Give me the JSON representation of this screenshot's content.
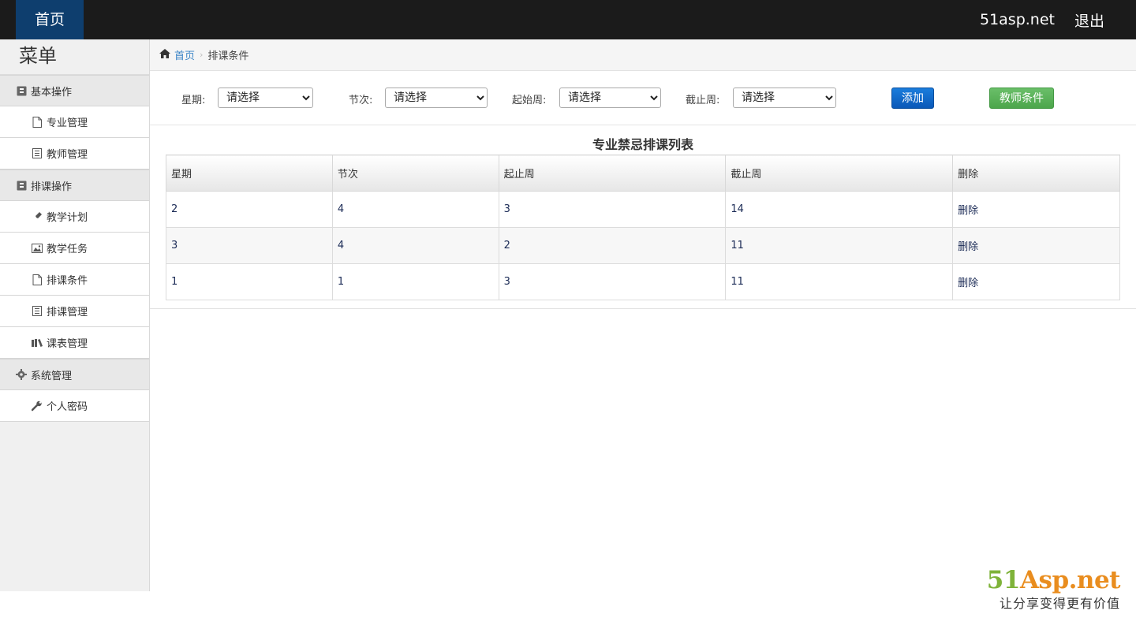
{
  "topbar": {
    "home_label": "首页",
    "site_label": "51asp.net",
    "logout_label": "退出"
  },
  "sidebar": {
    "title": "菜单",
    "groups": [
      {
        "label": "基本操作",
        "icon": "book-icon",
        "items": [
          {
            "label": "专业管理",
            "icon": "file-icon"
          },
          {
            "label": "教师管理",
            "icon": "list-icon"
          }
        ]
      },
      {
        "label": "排课操作",
        "icon": "book-icon",
        "items": [
          {
            "label": "教学计划",
            "icon": "fire-icon"
          },
          {
            "label": "教学任务",
            "icon": "picture-icon"
          },
          {
            "label": "排课条件",
            "icon": "file-icon"
          },
          {
            "label": "排课管理",
            "icon": "list-icon"
          },
          {
            "label": "课表管理",
            "icon": "books-icon"
          }
        ]
      },
      {
        "label": "系统管理",
        "icon": "gear-icon",
        "items": [
          {
            "label": "个人密码",
            "icon": "wrench-icon"
          }
        ]
      }
    ]
  },
  "breadcrumb": {
    "home": "首页",
    "current": "排课条件"
  },
  "filter": {
    "weekday_label": "星期:",
    "period_label": "节次:",
    "start_week_label": "起始周:",
    "end_week_label": "截止周:",
    "weekday_value": "请选择",
    "period_value": "请选择",
    "start_week_value": "请选择",
    "end_week_value": "请选择",
    "add_label": "添加",
    "teacher_label": "教师条件"
  },
  "table": {
    "title": "专业禁忌排课列表",
    "headers": [
      "星期",
      "节次",
      "起止周",
      "截止周",
      "删除"
    ],
    "rows": [
      {
        "weekday": "2",
        "period": "4",
        "start": "3",
        "end": "14",
        "action": "删除"
      },
      {
        "weekday": "3",
        "period": "4",
        "start": "2",
        "end": "11",
        "action": "删除"
      },
      {
        "weekday": "1",
        "period": "1",
        "start": "3",
        "end": "11",
        "action": "删除"
      }
    ]
  },
  "watermark": {
    "logo_a": "51",
    "logo_b": "Asp.net",
    "slogan": "让分享变得更有价值"
  },
  "colors": {
    "topbar": "#1b1b1b",
    "home_tab": "#0e3e6e",
    "add_button": "#0a58b8",
    "teacher_button": "#4ca64b",
    "link": "#3a84c6"
  }
}
